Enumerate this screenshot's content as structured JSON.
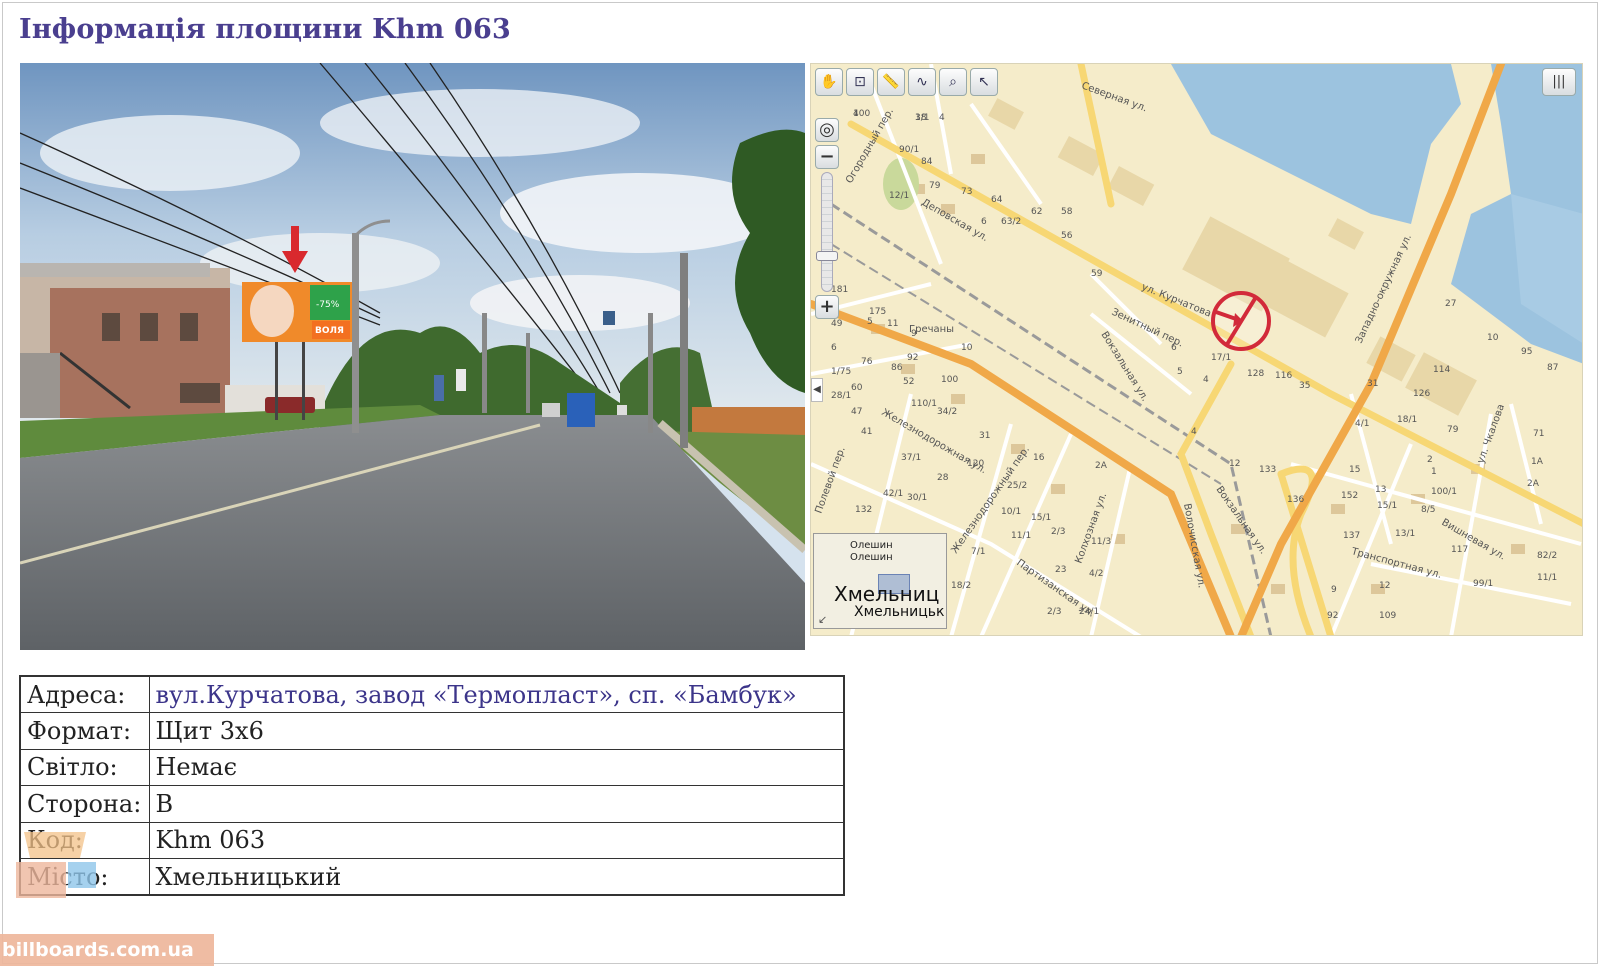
{
  "page": {
    "title": "Інформація площини Khm 063"
  },
  "photo": {
    "billboard": {
      "discount": "-75%",
      "brand": "ВОЛЯ"
    }
  },
  "map": {
    "toolbar_icons": [
      "hand-icon",
      "zoom-area-icon",
      "ruler-icon",
      "route-icon",
      "magnifier-icon",
      "pointer-icon"
    ],
    "streets": [
      "Северная ул.",
      "Огородный пер.",
      "Деповская ул.",
      "ул. Курчатова",
      "Зенитный пер.",
      "Вокзальная ул.",
      "Западно-окружная ул.",
      "ул. Чкалова",
      "Железнодорожная ул.",
      "Полевой пер.",
      "Железнодорожный пер.",
      "Колхозная ул.",
      "Волочисская ул.",
      "Вокзальная ул.",
      "Транспортная ул.",
      "Вишневая ул.",
      "Партизанская ул.",
      "Гречаны"
    ],
    "house_numbers": [
      "100",
      "18",
      "4",
      "90/1",
      "84",
      "79",
      "73",
      "64",
      "62",
      "58",
      "12/1",
      "6",
      "63/2",
      "56",
      "59",
      "181",
      "175",
      "49",
      "5",
      "11",
      "9",
      "10",
      "6",
      "76",
      "86",
      "92",
      "1/75",
      "60",
      "52",
      "100",
      "110/1",
      "34/2",
      "28/1",
      "47",
      "41",
      "37/1",
      "31",
      "120",
      "16",
      "132",
      "42/1",
      "30/1",
      "28",
      "25/2",
      "10/1",
      "15/1",
      "11/1",
      "2/3",
      "11/3",
      "7/1",
      "2А",
      "23",
      "4/2",
      "18/2",
      "2/3",
      "24/1",
      "5",
      "4",
      "17/1",
      "6",
      "4",
      "12",
      "133",
      "136",
      "128",
      "116",
      "35",
      "31",
      "27",
      "10",
      "95",
      "87",
      "79",
      "71",
      "1А",
      "2А",
      "18/1",
      "4/1",
      "15",
      "13",
      "15/1",
      "152",
      "137",
      "13/1",
      "100/1",
      "117",
      "9",
      "12",
      "92",
      "109",
      "99/1",
      "82/2",
      "11/1",
      "114",
      "126",
      "2",
      "1",
      "8/5",
      "4",
      "3/1"
    ],
    "overview": {
      "label_top": "Олешин",
      "label_top2": "Олешин",
      "city_big": "Хмельниц",
      "city_small": "Хмельницьк"
    },
    "layers_label": "|||"
  },
  "info": {
    "rows": [
      {
        "key": "Адреса:",
        "value": "вул.Курчатова, завод «Термопласт», сп. «Бамбук»"
      },
      {
        "key": "Формат:",
        "value": "Щит 3х6"
      },
      {
        "key": "Світло:",
        "value": "Немає"
      },
      {
        "key": "Сторона:",
        "value": "В"
      },
      {
        "key": "Код:",
        "value": "Khm 063"
      },
      {
        "key": "Місто:",
        "value": "Хмельницький"
      }
    ]
  },
  "watermark": {
    "text": "billboards.com.ua"
  },
  "colors": {
    "title": "#4a3f8f",
    "map_bg": "#f5ecca",
    "road_main": "#f0a848",
    "road_yellow": "#f7d774",
    "water": "#9cc3df",
    "marker": "#d22a3a"
  }
}
